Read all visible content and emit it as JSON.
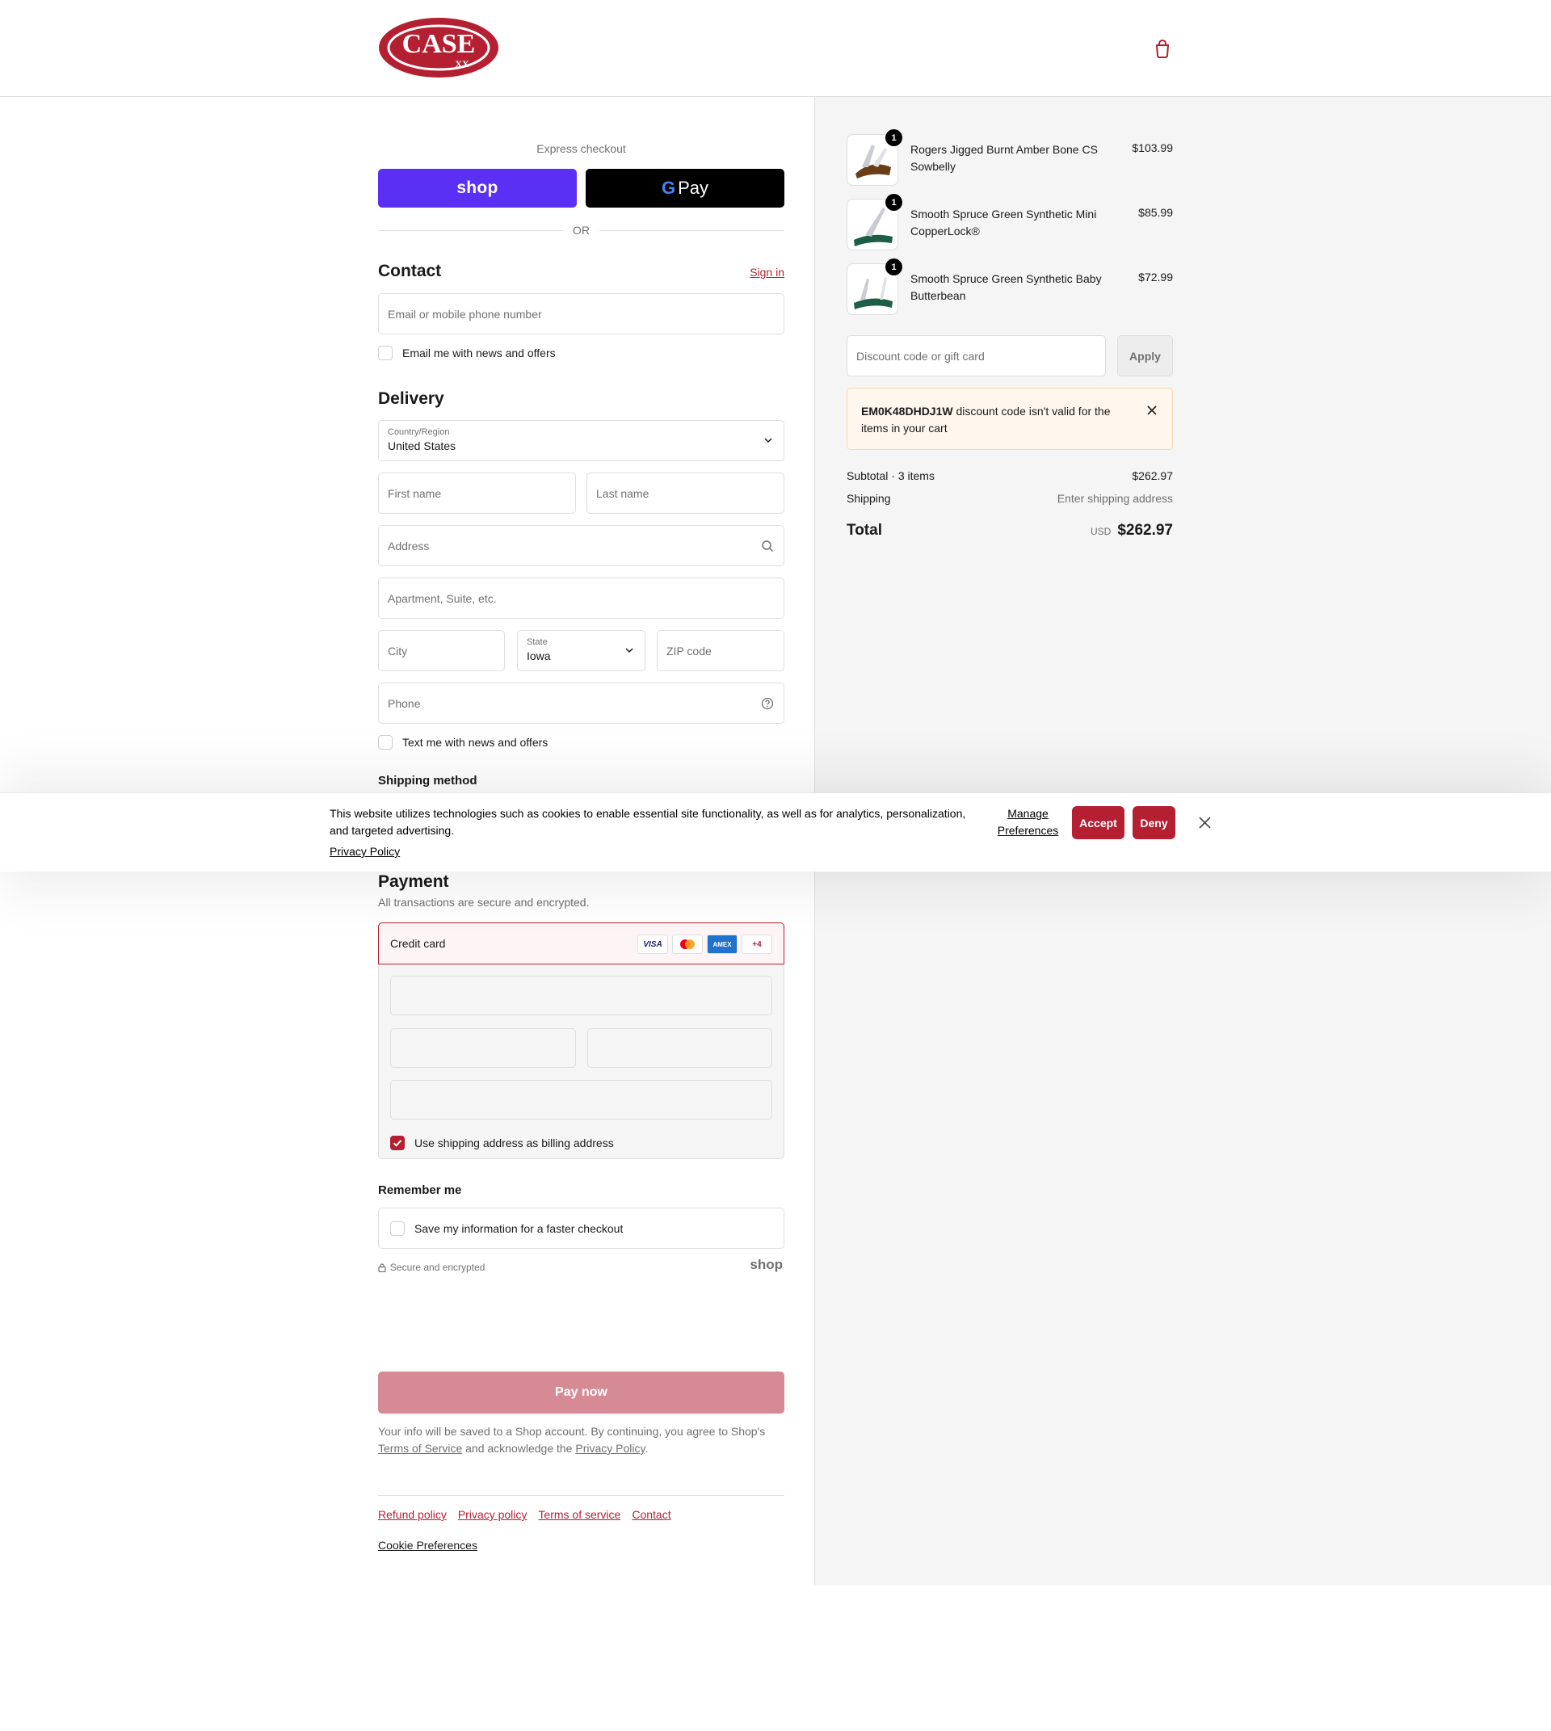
{
  "header": {
    "logo_text": "CASE",
    "logo_sub": "XX"
  },
  "express": {
    "title": "Express checkout",
    "shop_label": "shop",
    "gpay_label": "Pay",
    "gpay_g": "G",
    "or_label": "OR"
  },
  "contact": {
    "title": "Contact",
    "sign_in": "Sign in",
    "email_placeholder": "Email or mobile phone number",
    "news_label": "Email me with news and offers"
  },
  "delivery": {
    "title": "Delivery",
    "country_label": "Country/Region",
    "country_value": "United States",
    "first_name_placeholder": "First name",
    "last_name_placeholder": "Last name",
    "address_placeholder": "Address",
    "apartment_placeholder": "Apartment, Suite, etc.",
    "city_placeholder": "City",
    "state_label": "State",
    "state_value": "Iowa",
    "zip_placeholder": "ZIP code",
    "phone_placeholder": "Phone",
    "text_label": "Text me with news and offers"
  },
  "shipping_method": {
    "title": "Shipping method"
  },
  "payment": {
    "title": "Payment",
    "subtitle": "All transactions are secure and encrypted.",
    "credit_card_label": "Credit card",
    "cards": [
      "VISA",
      "",
      "AMEX",
      "+4"
    ],
    "billing_label": "Use shipping address as billing address"
  },
  "remember": {
    "title": "Remember me",
    "save_label": "Save my information for a faster checkout",
    "secure_label": "Secure and encrypted",
    "shop_mark": "shop"
  },
  "pay_now": {
    "label": "Pay now",
    "legal_prefix": "Your info will be saved to a Shop account. By continuing, you agree to Shop's",
    "terms": "Terms of Service",
    "legal_mid": "and acknowledge the",
    "privacy": "Privacy Policy",
    "legal_end": "."
  },
  "footer": {
    "links": [
      "Refund policy",
      "Privacy policy",
      "Terms of service",
      "Contact"
    ],
    "cookie_preferences": "Cookie Preferences"
  },
  "summary": {
    "items": [
      {
        "name": "Rogers Jigged Burnt Amber Bone CS Sowbelly",
        "price": "$103.99",
        "qty": "1",
        "handle_color": "#6b3d16"
      },
      {
        "name": "Smooth Spruce Green Synthetic Mini CopperLock®",
        "price": "$85.99",
        "qty": "1",
        "handle_color": "#1d5e45"
      },
      {
        "name": "Smooth Spruce Green Synthetic Baby Butterbean",
        "price": "$72.99",
        "qty": "1",
        "handle_color": "#1d5e45"
      }
    ],
    "discount_placeholder": "Discount code or gift card",
    "apply_label": "Apply",
    "alert_code": "EM0K48DHDJ1W",
    "alert_message": "discount code isn't valid for the items in your cart",
    "subtotal_label": "Subtotal · 3 items",
    "subtotal_value": "$262.97",
    "shipping_label": "Shipping",
    "shipping_value": "Enter shipping address",
    "total_label": "Total",
    "total_currency": "USD",
    "total_value": "$262.97"
  },
  "cookie_banner": {
    "text": "This website utilizes technologies such as cookies to enable essential site functionality, as well as for analytics, personalization, and targeted advertising.",
    "policy_link": "Privacy Policy",
    "manage": "Manage Preferences",
    "accept": "Accept",
    "deny": "Deny"
  },
  "colors": {
    "brand": "#b41f32",
    "shop_purple": "#5a31f4",
    "pay_disabled": "#d68a93"
  }
}
